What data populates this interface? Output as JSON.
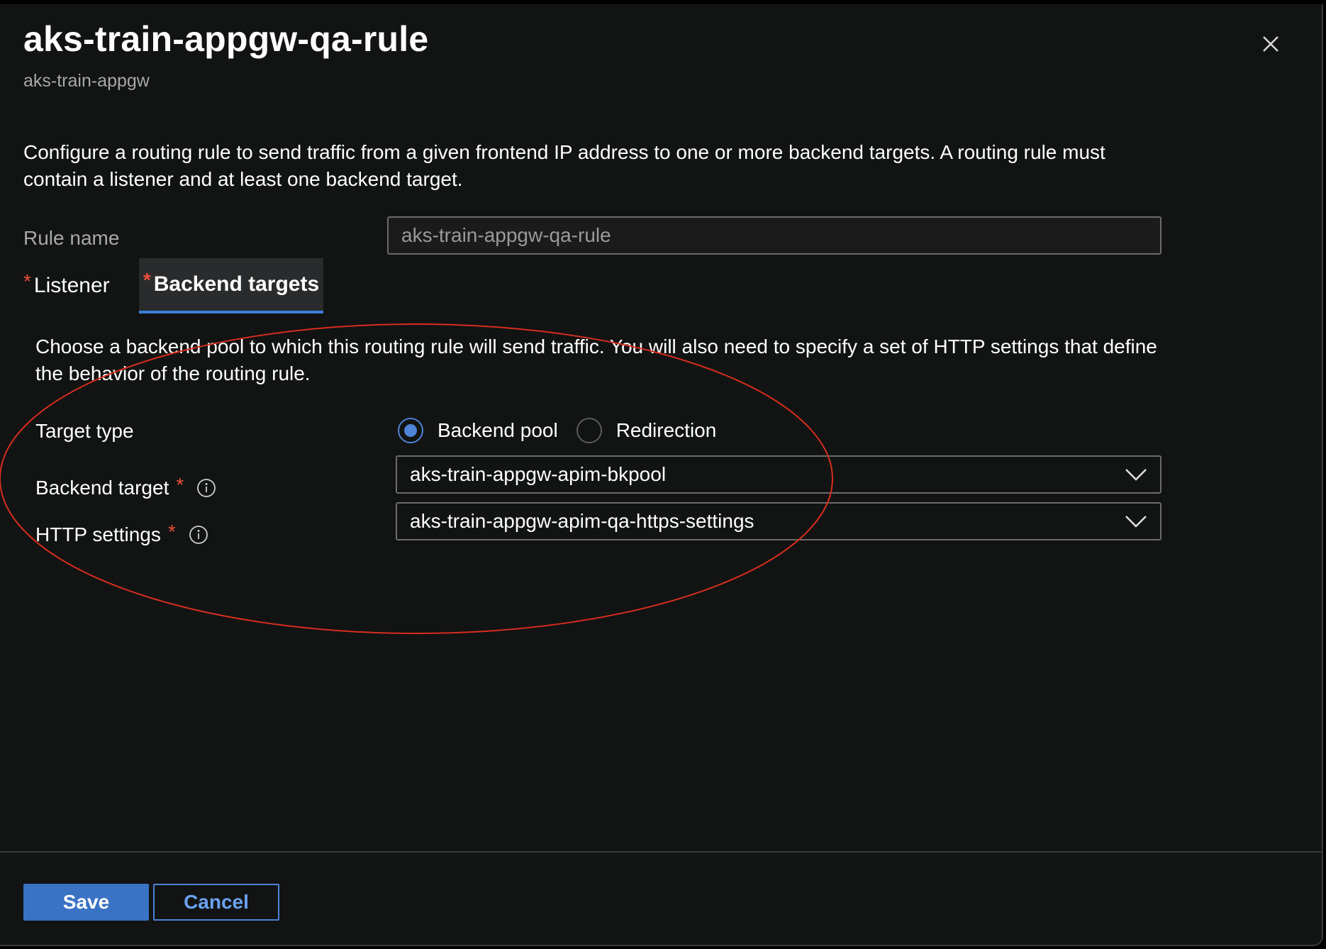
{
  "header": {
    "title": "aks-train-appgw-qa-rule",
    "subtitle": "aks-train-appgw",
    "close_icon": "close-icon"
  },
  "intro_text": "Configure a routing rule to send traffic from a given frontend IP address to one or more backend targets. A routing rule must contain a listener and at least one backend target.",
  "rule_name": {
    "label": "Rule name",
    "value": "aks-train-appgw-qa-rule"
  },
  "tabs": [
    {
      "label": "Listener",
      "required_marker": "*",
      "selected": false
    },
    {
      "label": "Backend targets",
      "required_marker": "*",
      "selected": true
    }
  ],
  "backend": {
    "description": "Choose a backend pool to which this routing rule will send traffic. You will also need to specify a set of HTTP settings that define the behavior of the routing rule.",
    "target_type": {
      "label": "Target type",
      "options": [
        {
          "label": "Backend pool",
          "selected": true
        },
        {
          "label": "Redirection",
          "selected": false
        }
      ]
    },
    "backend_target": {
      "label": "Backend target",
      "required_marker": "*",
      "value": "aks-train-appgw-apim-bkpool"
    },
    "http_settings": {
      "label": "HTTP settings",
      "required_marker": "*",
      "value": "aks-train-appgw-apim-qa-https-settings"
    }
  },
  "footer": {
    "save_label": "Save",
    "cancel_label": "Cancel"
  },
  "colors": {
    "background": "#121313",
    "accent": "#3a72c4",
    "required": "#e8503a",
    "annotation": "#d62e1f"
  }
}
